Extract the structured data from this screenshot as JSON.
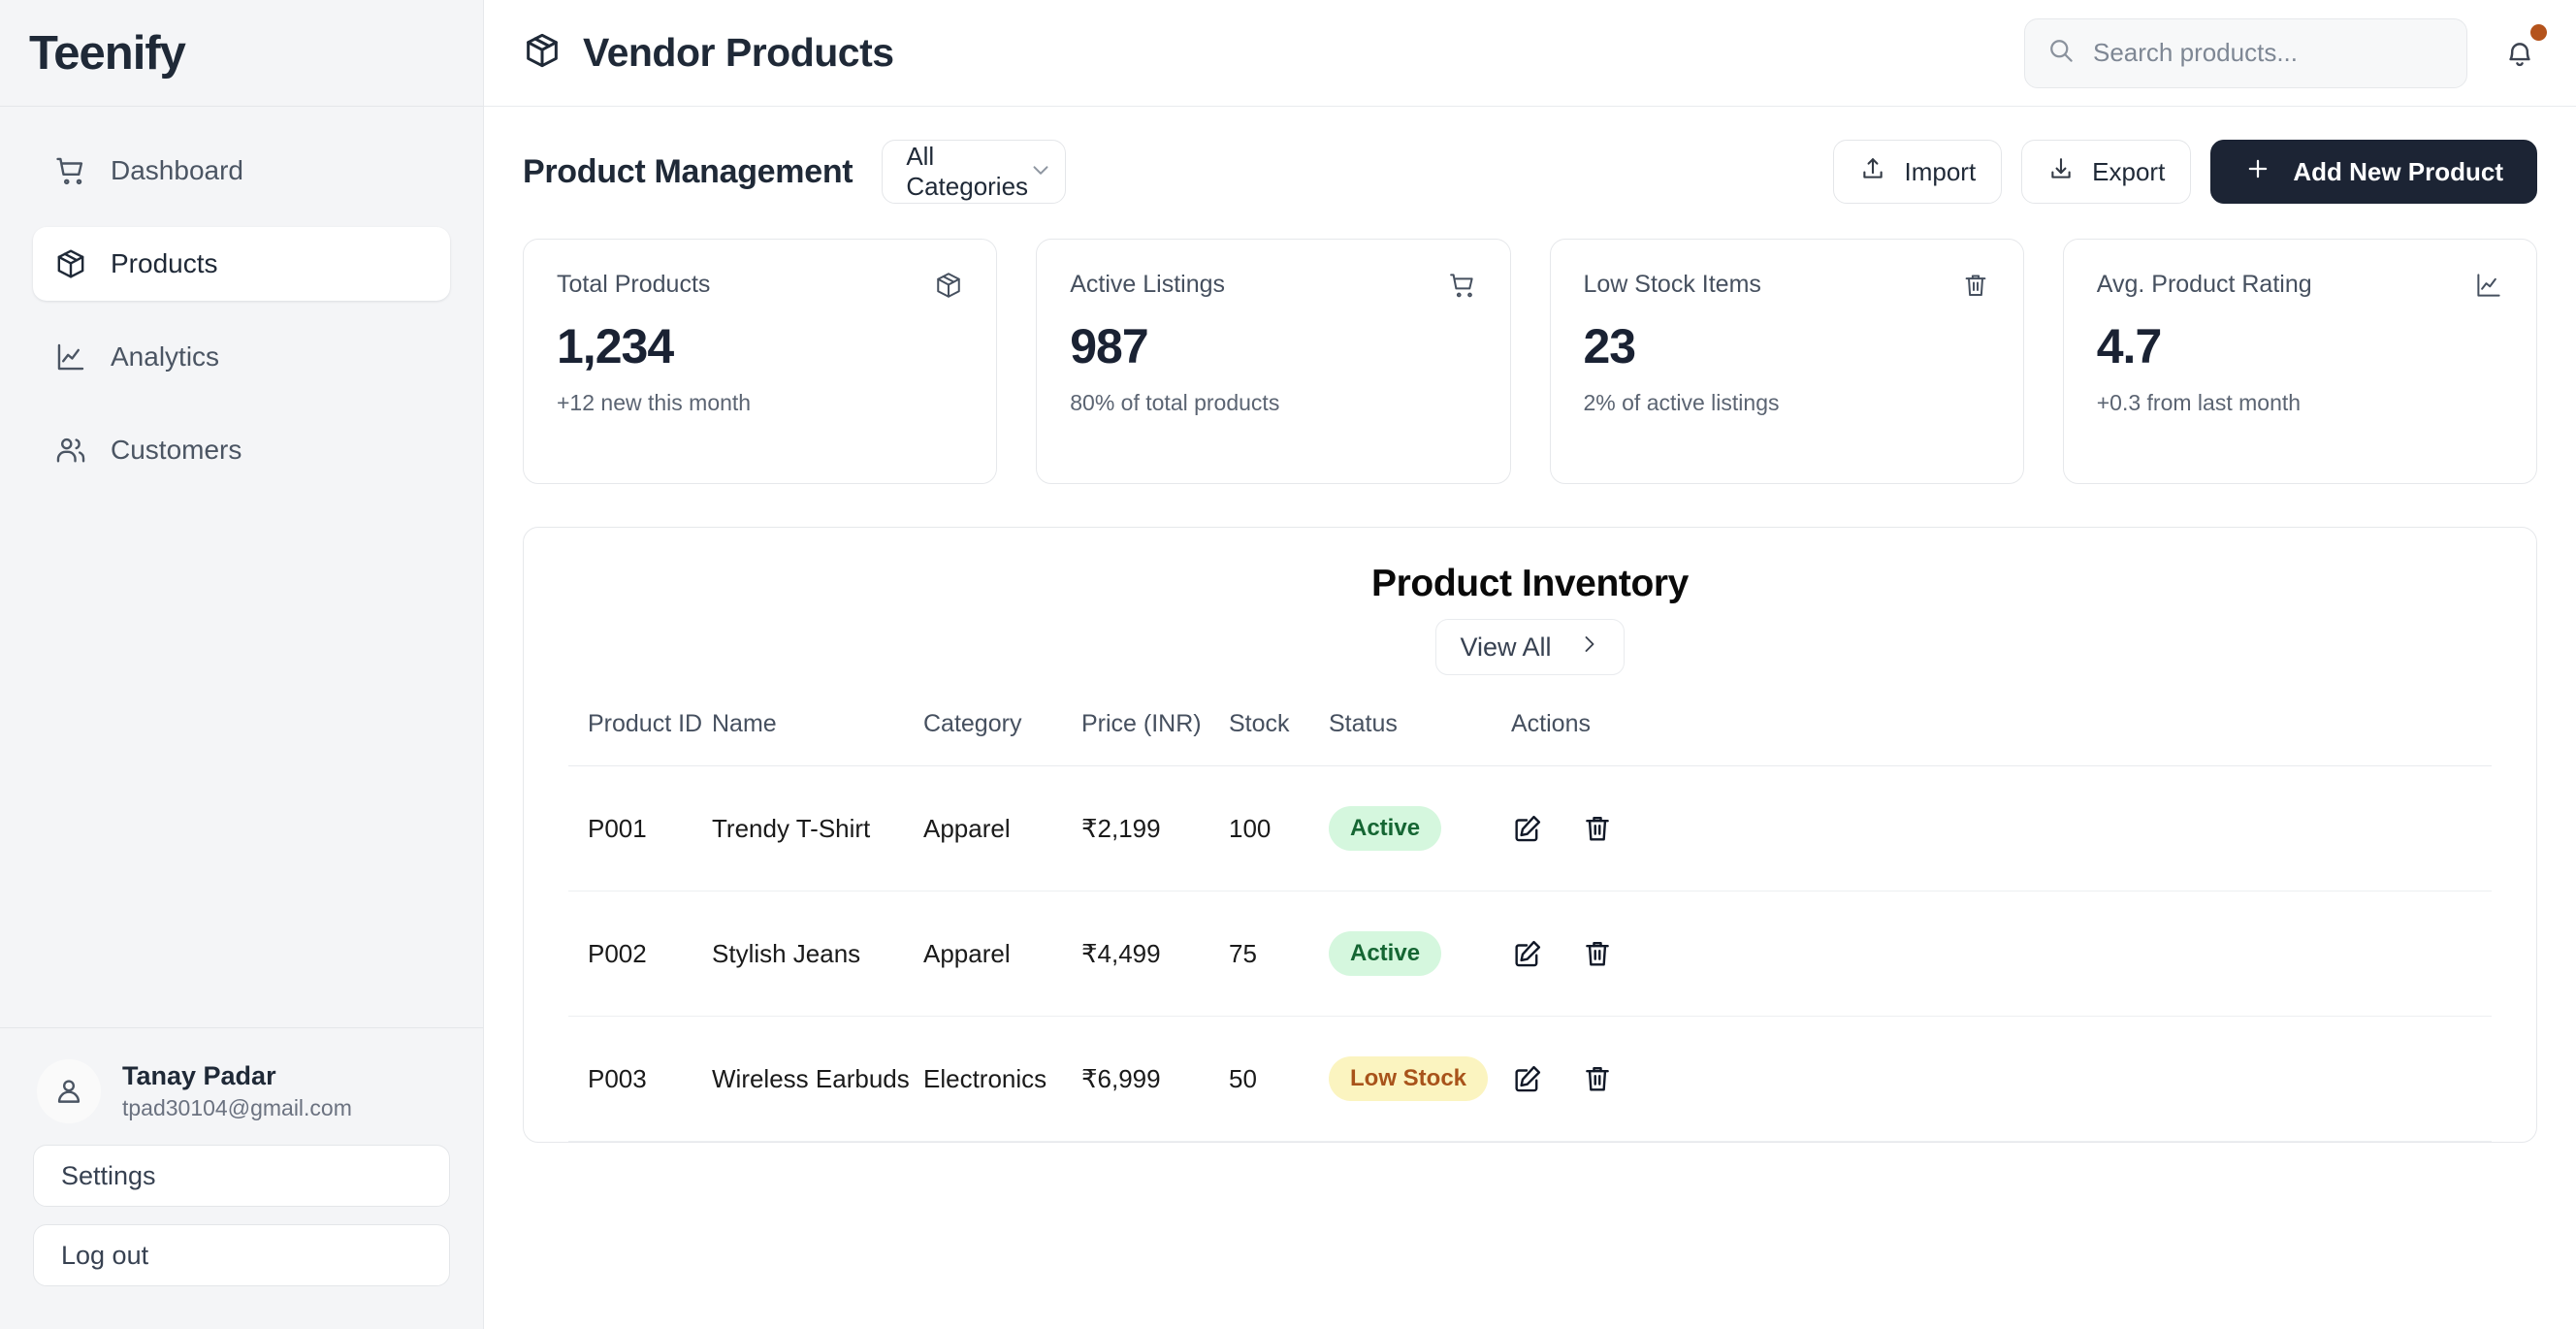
{
  "sidebar": {
    "brand": "Teenify",
    "items": [
      {
        "label": "Dashboard",
        "icon": "cart-icon",
        "active": false
      },
      {
        "label": "Products",
        "icon": "package-icon",
        "active": true
      },
      {
        "label": "Analytics",
        "icon": "chart-line-icon",
        "active": false
      },
      {
        "label": "Customers",
        "icon": "users-icon",
        "active": false
      }
    ],
    "user": {
      "name": "Tanay Padar",
      "email": "tpad30104@gmail.com",
      "avatar_icon": "person-icon"
    },
    "settings_label": "Settings",
    "logout_label": "Log out"
  },
  "header": {
    "title": "Vendor Products",
    "title_icon": "package-icon",
    "search": {
      "placeholder": "Search products...",
      "value": "",
      "icon": "search-icon"
    },
    "notification": {
      "icon": "bell-icon",
      "has_unread": true,
      "dot_color": "#b4531c"
    }
  },
  "toolbar": {
    "title": "Product Management",
    "category_filter": {
      "selected": "All Categories",
      "icon": "chevron-down-icon"
    },
    "import_label": "Import",
    "import_icon": "upload-icon",
    "export_label": "Export",
    "export_icon": "download-icon",
    "add_label": "Add New Product",
    "add_icon": "plus-icon",
    "add_bg": "#1c2434"
  },
  "stats": [
    {
      "label": "Total Products",
      "value": "1,234",
      "sub": "+12 new this month",
      "icon": "package-icon"
    },
    {
      "label": "Active Listings",
      "value": "987",
      "sub": "80% of total products",
      "icon": "cart-icon"
    },
    {
      "label": "Low Stock Items",
      "value": "23",
      "sub": "2% of active listings",
      "icon": "trash-icon"
    },
    {
      "label": "Avg. Product Rating",
      "value": "4.7",
      "sub": "+0.3 from last month",
      "icon": "chart-line-icon"
    }
  ],
  "inventory": {
    "title": "Product Inventory",
    "view_all_label": "View All",
    "view_all_icon": "chevron-right-icon",
    "columns": [
      "Product ID",
      "Name",
      "Category",
      "Price (INR)",
      "Stock",
      "Status",
      "Actions"
    ],
    "rows": [
      {
        "id": "P001",
        "name": "Trendy T-Shirt",
        "category": "Apparel",
        "price": "₹2,199",
        "stock": "100",
        "status": "Active",
        "status_type": "active",
        "edit_icon": "edit-icon",
        "delete_icon": "trash-icon"
      },
      {
        "id": "P002",
        "name": "Stylish Jeans",
        "category": "Apparel",
        "price": "₹4,499",
        "stock": "75",
        "status": "Active",
        "status_type": "active",
        "edit_icon": "edit-icon",
        "delete_icon": "trash-icon"
      },
      {
        "id": "P003",
        "name": "Wireless Earbuds",
        "category": "Electronics",
        "price": "₹6,999",
        "stock": "50",
        "status": "Low Stock",
        "status_type": "low",
        "edit_icon": "edit-icon",
        "delete_icon": "trash-icon"
      }
    ],
    "status_colors": {
      "active_bg": "#d5f7de",
      "active_fg": "#156633",
      "low_bg": "#fbf4c0",
      "low_fg": "#a8531a"
    }
  }
}
